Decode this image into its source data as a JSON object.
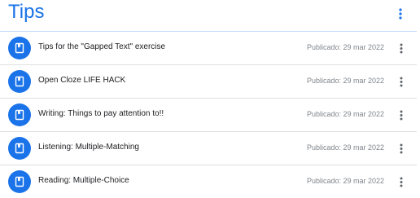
{
  "header": {
    "title": "Tips",
    "menu_icon": "more-vert-icon",
    "accent_color": "#1a73e8"
  },
  "items": [
    {
      "title": "Tips for the \"Gapped Text\" exercise",
      "date": "Publicado: 29 mar 2022",
      "icon": "assignment-book-icon"
    },
    {
      "title": "Open Cloze LIFE HACK",
      "date": "Publicado: 29 mar 2022",
      "icon": "assignment-book-icon"
    },
    {
      "title": "Writing: Things to pay attention to!!",
      "date": "Publicado: 29 mar 2022",
      "icon": "assignment-book-icon"
    },
    {
      "title": "Listening: Multiple-Matching",
      "date": "Publicado: 29 mar 2022",
      "icon": "assignment-book-icon"
    },
    {
      "title": "Reading: Multiple-Choice",
      "date": "Publicado: 29 mar 2022",
      "icon": "assignment-book-icon"
    }
  ]
}
